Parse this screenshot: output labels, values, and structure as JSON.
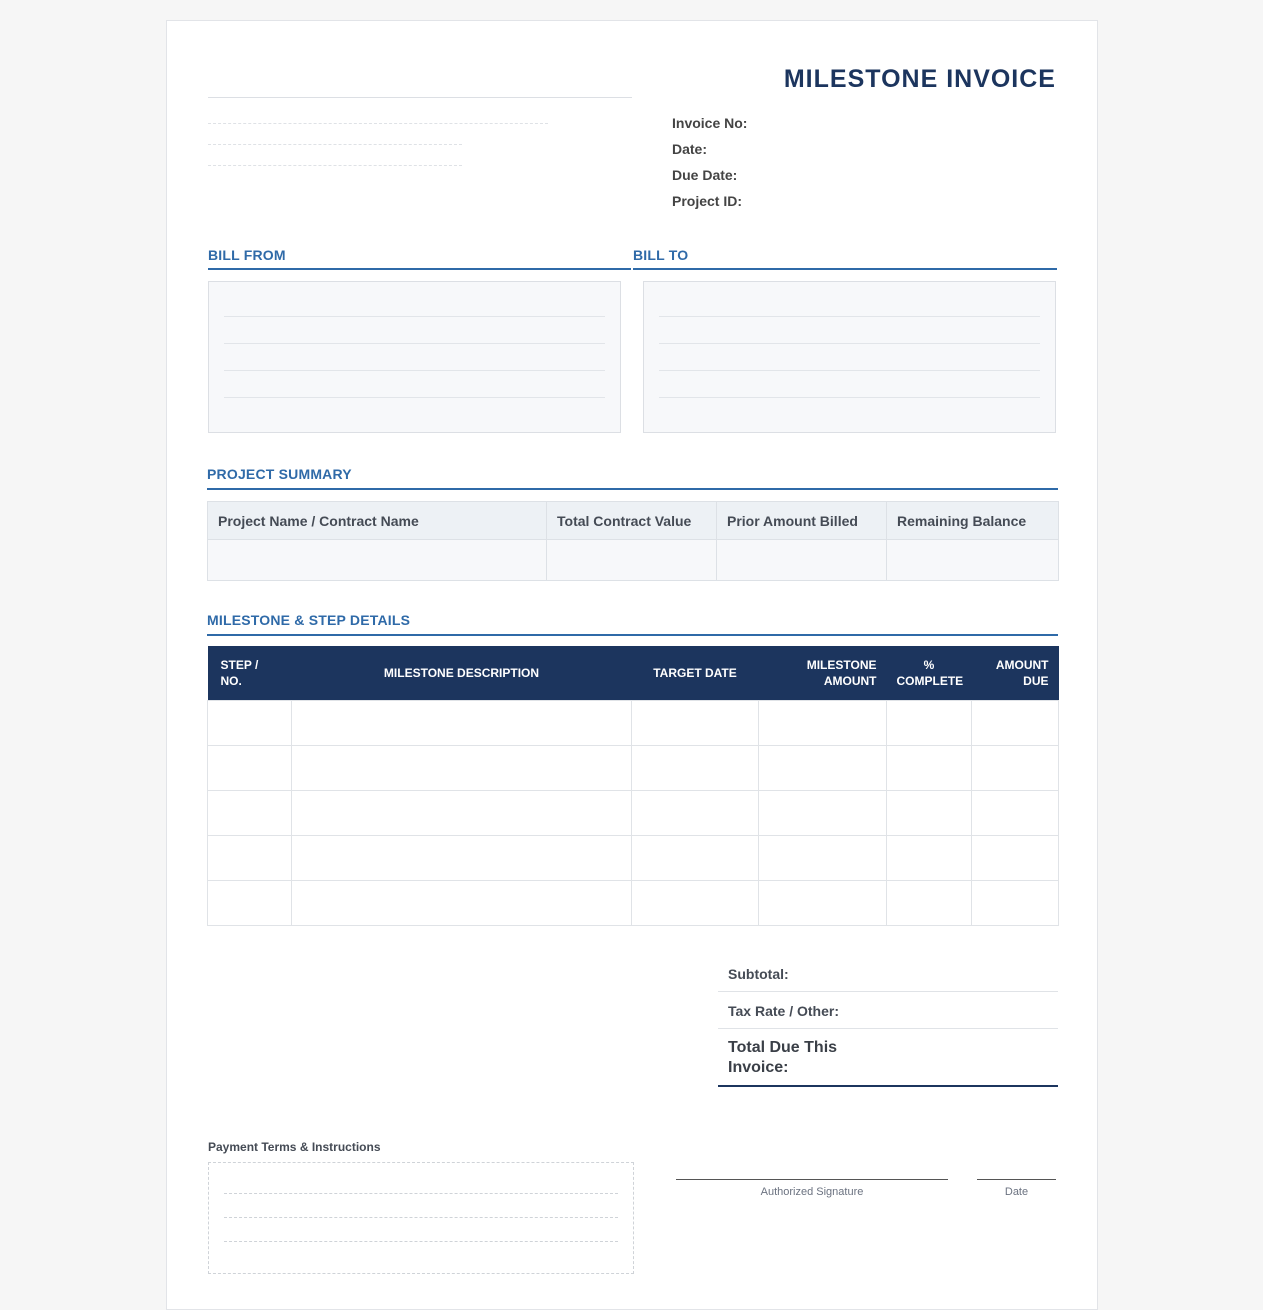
{
  "header": {
    "title": "MILESTONE INVOICE",
    "meta": [
      "Invoice No:",
      "Date:",
      "Due Date:",
      "Project ID:"
    ]
  },
  "parties": {
    "bill_from": "BILL FROM",
    "bill_to": "BILL TO"
  },
  "summary": {
    "title": "PROJECT SUMMARY",
    "columns": [
      "Project Name / Contract Name",
      "Total Contract Value",
      "Prior Amount Billed",
      "Remaining Balance"
    ]
  },
  "details": {
    "title": "MILESTONE & STEP DETAILS",
    "columns": [
      "STEP / NO.",
      "MILESTONE DESCRIPTION",
      "TARGET DATE",
      "MILESTONE AMOUNT",
      "% COMPLETE",
      "AMOUNT DUE"
    ],
    "row_count": 5
  },
  "totals": {
    "subtotal": "Subtotal:",
    "tax": "Tax Rate / Other:",
    "total_due": "Total Due This Invoice:"
  },
  "payment": {
    "label": "Payment Terms & Instructions"
  },
  "signature": {
    "authorized": "Authorized Signature",
    "date": "Date"
  }
}
